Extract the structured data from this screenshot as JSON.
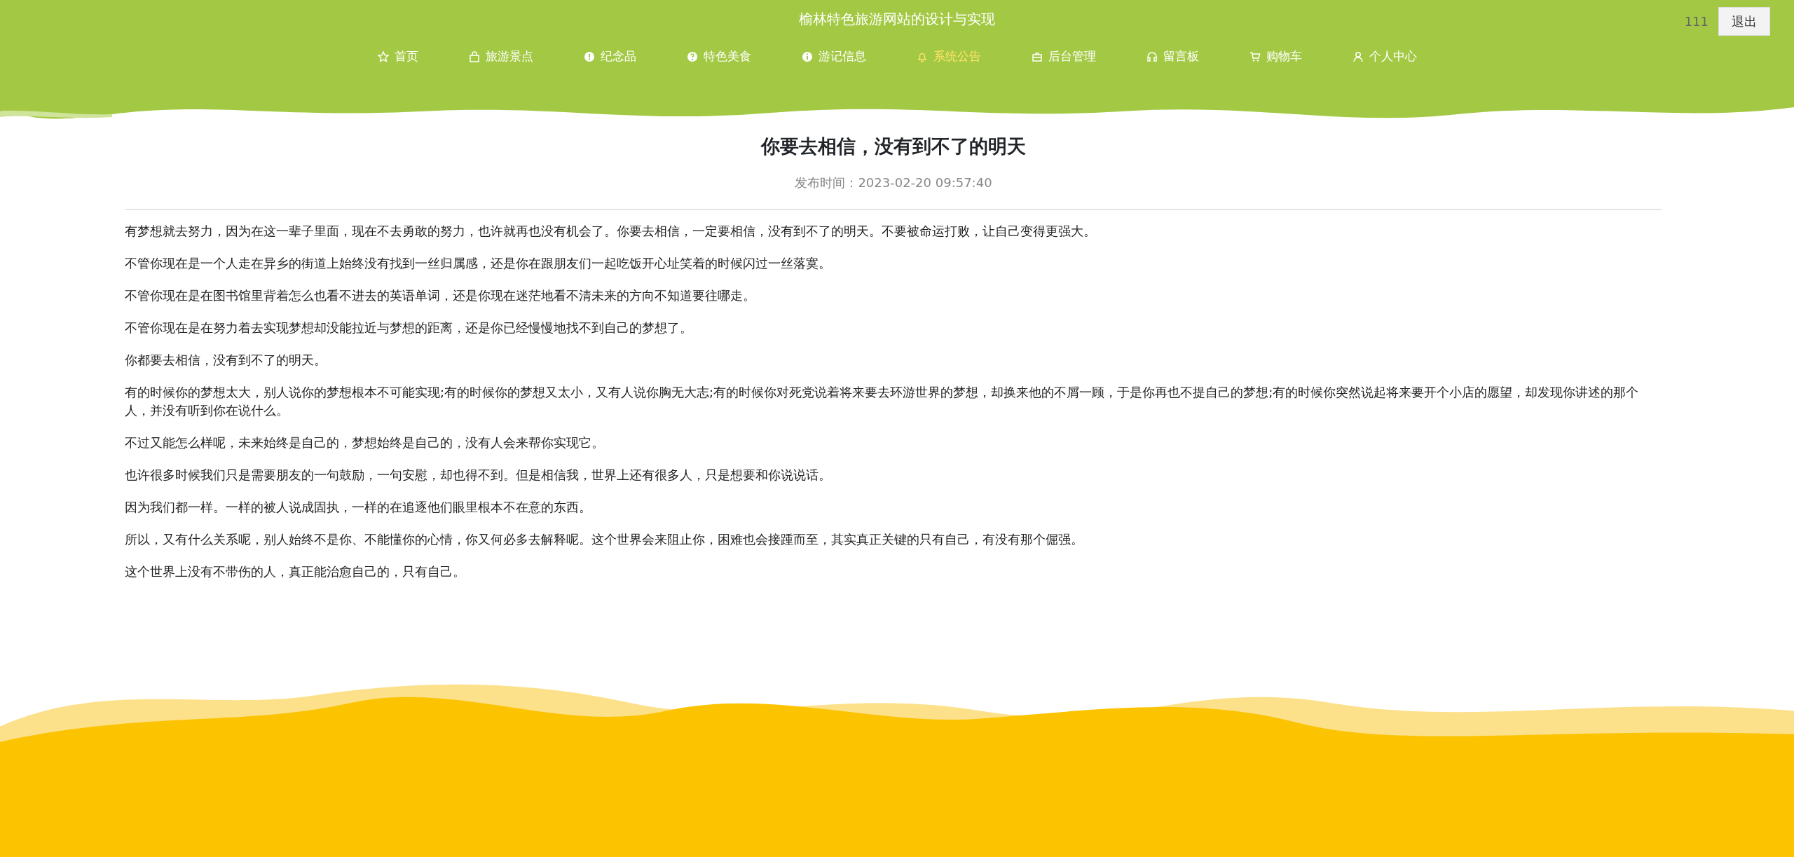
{
  "site_title": "榆林特色旅游网站的设计与实现",
  "user": {
    "name": "111",
    "logout": "退出"
  },
  "nav": [
    {
      "label": "首页",
      "selected": false
    },
    {
      "label": "旅游景点",
      "selected": false
    },
    {
      "label": "纪念品",
      "selected": false
    },
    {
      "label": "特色美食",
      "selected": false
    },
    {
      "label": "游记信息",
      "selected": false
    },
    {
      "label": "系统公告",
      "selected": true
    },
    {
      "label": "后台管理",
      "selected": false
    },
    {
      "label": "留言板",
      "selected": false
    },
    {
      "label": "购物车",
      "selected": false
    },
    {
      "label": "个人中心",
      "selected": false
    }
  ],
  "article": {
    "title": "你要去相信，没有到不了的明天",
    "published": "发布时间：2023-02-20 09:57:40",
    "paragraphs": [
      "有梦想就去努力，因为在这一辈子里面，现在不去勇敢的努力，也许就再也没有机会了。你要去相信，一定要相信，没有到不了的明天。不要被命运打败，让自己变得更强大。",
      "不管你现在是一个人走在异乡的街道上始终没有找到一丝归属感，还是你在跟朋友们一起吃饭开心址笑着的时候闪过一丝落寞。",
      "不管你现在是在图书馆里背着怎么也看不进去的英语单词，还是你现在迷茫地看不清未来的方向不知道要往哪走。",
      "不管你现在是在努力着去实现梦想却没能拉近与梦想的距离，还是你已经慢慢地找不到自己的梦想了。",
      "你都要去相信，没有到不了的明天。",
      "有的时候你的梦想太大，别人说你的梦想根本不可能实现;有的时候你的梦想又太小，又有人说你胸无大志;有的时候你对死党说着将来要去环游世界的梦想，却换来他的不屑一顾，于是你再也不提自己的梦想;有的时候你突然说起将来要开个小店的愿望，却发现你讲述的那个人，并没有听到你在说什么。",
      "不过又能怎么样呢，未来始终是自己的，梦想始终是自己的，没有人会来帮你实现它。",
      "也许很多时候我们只是需要朋友的一句鼓励，一句安慰，却也得不到。但是相信我，世界上还有很多人，只是想要和你说说话。",
      "因为我们都一样。一样的被人说成固执，一样的在追逐他们眼里根本不在意的东西。",
      "所以，又有什么关系呢，别人始终不是你、不能懂你的心情，你又何必多去解释呢。这个世界会来阻止你，困难也会接踵而至，其实真正关键的只有自己，有没有那个倔强。",
      "这个世界上没有不带伤的人，真正能治愈自己的，只有自己。"
    ]
  }
}
